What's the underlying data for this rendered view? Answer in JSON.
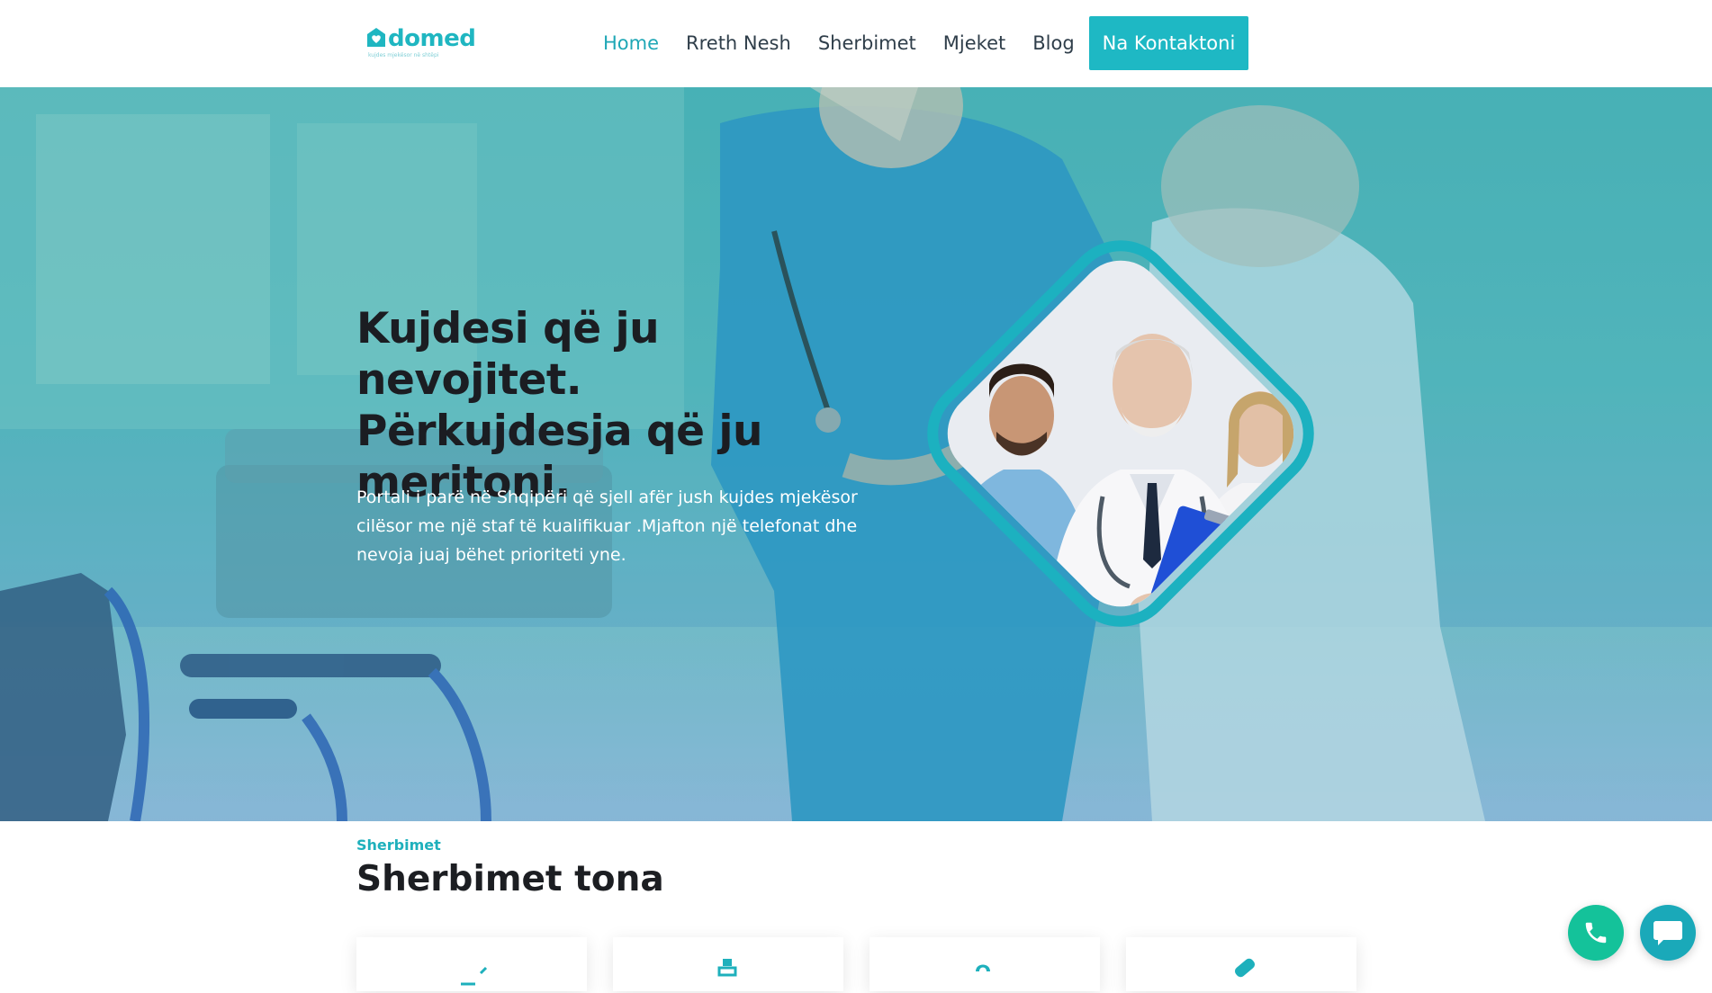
{
  "header": {
    "logo_text": "domed",
    "logo_tagline": "kujdes mjekësor në shtëpi",
    "nav": [
      {
        "label": "Home",
        "active": true
      },
      {
        "label": "Rreth Nesh",
        "active": false
      },
      {
        "label": "Sherbimet",
        "active": false
      },
      {
        "label": "Mjeket",
        "active": false
      },
      {
        "label": "Blog",
        "active": false
      }
    ],
    "cta_label": "Na Kontaktoni"
  },
  "hero": {
    "title_line1": "Kujdesi që ju nevojitet.",
    "title_line2": "Përkujdesja që ju",
    "title_line3": "meritoni.",
    "description": "Portali i parë në Shqipëri që sjell afër jush kujdes mjekësor cilësor me një staf të kualifikuar .Mjafton një telefonat dhe nevoja juaj bëhet prioriteti yne."
  },
  "services": {
    "tag": "Sherbimet",
    "title": "Sherbimet tona",
    "cards": [
      {
        "icon": "stethoscope-icon"
      },
      {
        "icon": "medical-chart-icon"
      },
      {
        "icon": "doctor-icon"
      },
      {
        "icon": "bandage-icon"
      }
    ]
  },
  "floating": {
    "phone_icon": "phone-icon",
    "chat_icon": "chat-icon"
  },
  "colors": {
    "accent": "#1eb8c4",
    "nav_active": "#1fa7b6",
    "phone_button": "#14c29a",
    "chat_button": "#1aa9b9"
  }
}
